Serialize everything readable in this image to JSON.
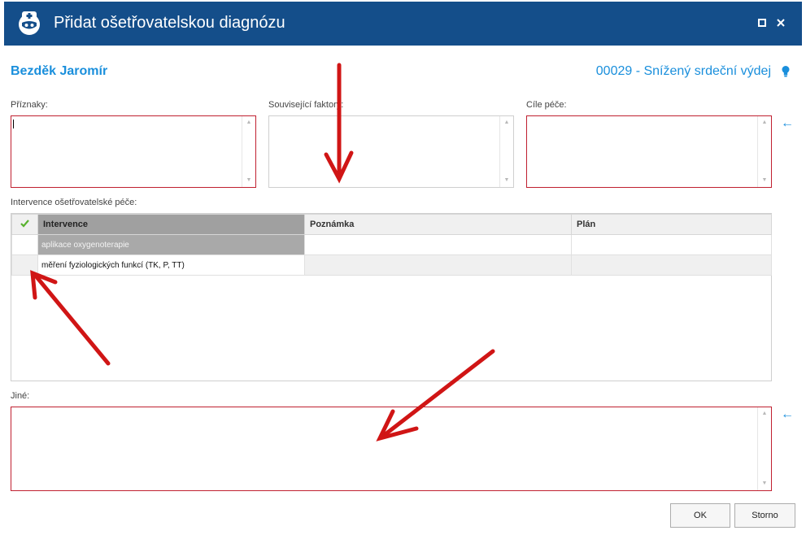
{
  "window": {
    "title": "Přidat ošetřovatelskou diagnózu",
    "maximize_icon": "maximize-icon",
    "close_icon": "close-icon",
    "app_icon": "nurse-icon",
    "header_color": "#144e8a"
  },
  "header": {
    "patient_name": "Bezděk Jaromír",
    "diagnosis": "00029 - Snížený srdeční výdej",
    "hint_icon": "lightbulb-icon",
    "accent_color": "#1a8fdc"
  },
  "fields": {
    "symptoms_label": "Příznaky:",
    "symptoms_value": "",
    "related_factors_label": "Související faktory:",
    "related_factors_value": "",
    "care_goals_label": "Cíle péče:",
    "care_goals_value": "",
    "interventions_label": "Intervence ošetřovatelské péče:",
    "other_label": "Jiné:",
    "other_value": "",
    "insert_icon": "arrow-left-icon"
  },
  "grid": {
    "columns": [
      "Intervence",
      "Poznámka",
      "Plán"
    ],
    "check_header_icon": "check-icon",
    "rows": [
      {
        "intervence": "aplikace oxygenoterapie",
        "poznamka": "",
        "plan": ""
      },
      {
        "intervence": "měření fyziologických funkcí (TK, P, TT)",
        "poznamka": "",
        "plan": ""
      }
    ]
  },
  "buttons": {
    "ok": "OK",
    "cancel": "Storno"
  },
  "annotation_color": "#d01515"
}
